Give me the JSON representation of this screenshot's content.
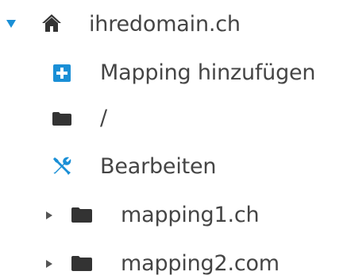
{
  "tree": {
    "root": {
      "label": "ihredomain.ch",
      "expanded": true,
      "icon": "home-icon"
    },
    "children": [
      {
        "label": "Mapping hinzufügen",
        "icon": "plus-square-icon"
      },
      {
        "label": "/",
        "icon": "folder-icon"
      },
      {
        "label": "Bearbeiten",
        "icon": "tools-icon"
      },
      {
        "label": "mapping1.ch",
        "icon": "folder-icon",
        "expanded": false
      },
      {
        "label": "mapping2.com",
        "icon": "folder-icon",
        "expanded": false
      }
    ]
  },
  "colors": {
    "accent": "#1a8fd6",
    "text": "#454545",
    "icon_dark": "#333333"
  }
}
